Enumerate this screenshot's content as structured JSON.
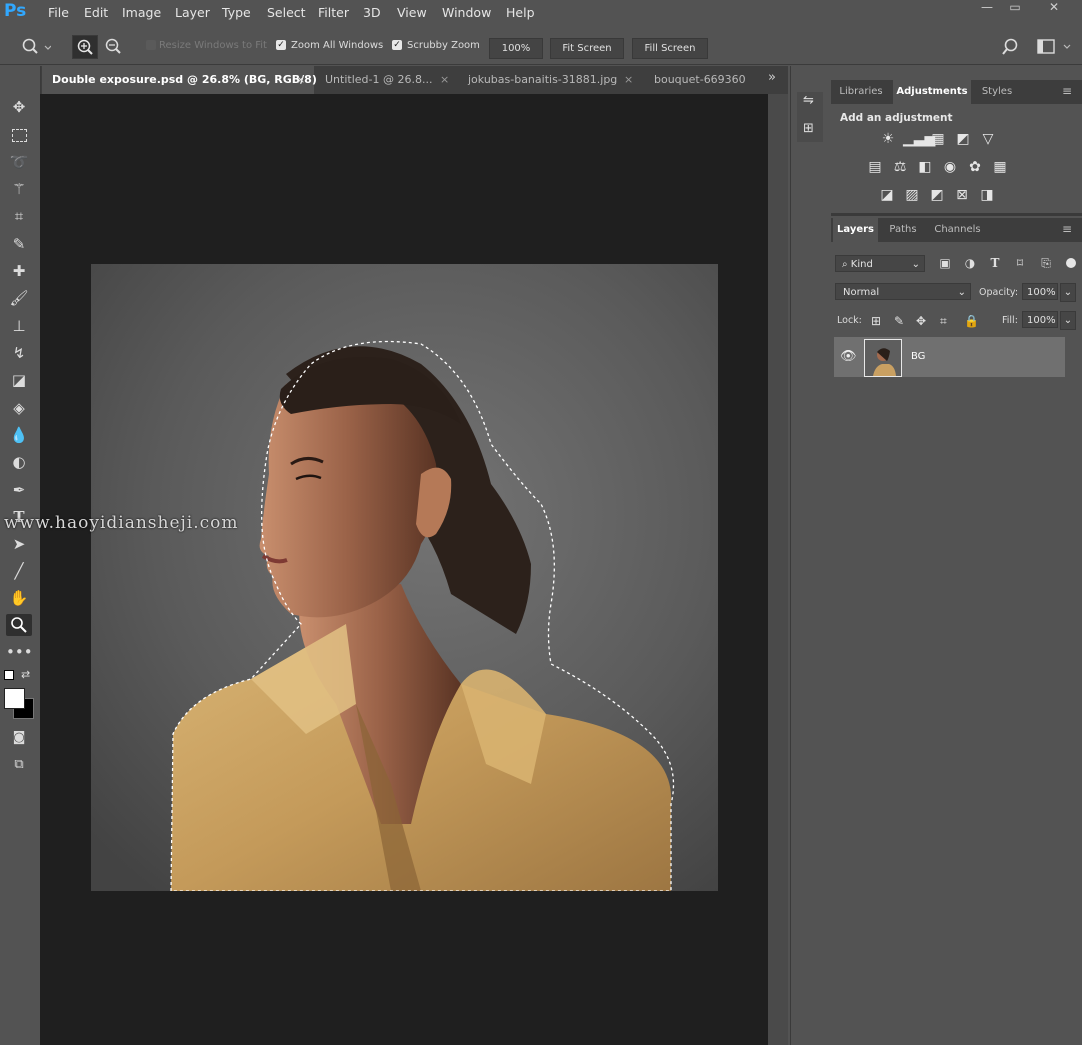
{
  "app": {
    "logo": "Ps"
  },
  "menu": [
    "File",
    "Edit",
    "Image",
    "Layer",
    "Type",
    "Select",
    "Filter",
    "3D",
    "View",
    "Window",
    "Help"
  ],
  "window_controls": {
    "minimize": "—",
    "restore": "▭",
    "close": "✕"
  },
  "options": {
    "tool_icon": "zoom-icon",
    "resize_windows_label": "Resize Windows to Fit",
    "zoom_all_windows_label": "Zoom All Windows",
    "scrubby_zoom_label": "Scrubby Zoom",
    "zoom_value": "100%",
    "fit_screen_label": "Fit Screen",
    "fill_screen_label": "Fill Screen"
  },
  "tabs": [
    {
      "label": "Double exposure.psd @ 26.8% (BG, RGB/8)",
      "active": true,
      "close": "×"
    },
    {
      "label": "Untitled-1 @ 26.8...",
      "active": false,
      "close": "×"
    },
    {
      "label": "jokubas-banaitis-31881.jpg",
      "active": false,
      "close": "×"
    },
    {
      "label": "bouquet-669360",
      "active": false
    }
  ],
  "tabs_overflow": "»",
  "top_panel": {
    "tabs": [
      "Libraries",
      "Adjustments",
      "Styles"
    ],
    "active": "Adjustments",
    "heading": "Add an adjustment"
  },
  "layers_panel": {
    "tabs": [
      "Layers",
      "Paths",
      "Channels"
    ],
    "active": "Layers",
    "filter_kind": "Kind",
    "blend_mode": "Normal",
    "opacity_label": "Opacity:",
    "opacity_value": "100%",
    "lock_label": "Lock:",
    "fill_label": "Fill:",
    "fill_value": "100%",
    "layers": [
      {
        "name": "BG",
        "visible": true
      }
    ]
  },
  "watermark": "www.haoyidiansheji.com",
  "colors": {
    "accent": "#31a8ff",
    "canvas_bg": "#1f1f1f",
    "panel_bg": "#535353",
    "layer_selected": "#707070",
    "shirt": "#c9a062"
  }
}
